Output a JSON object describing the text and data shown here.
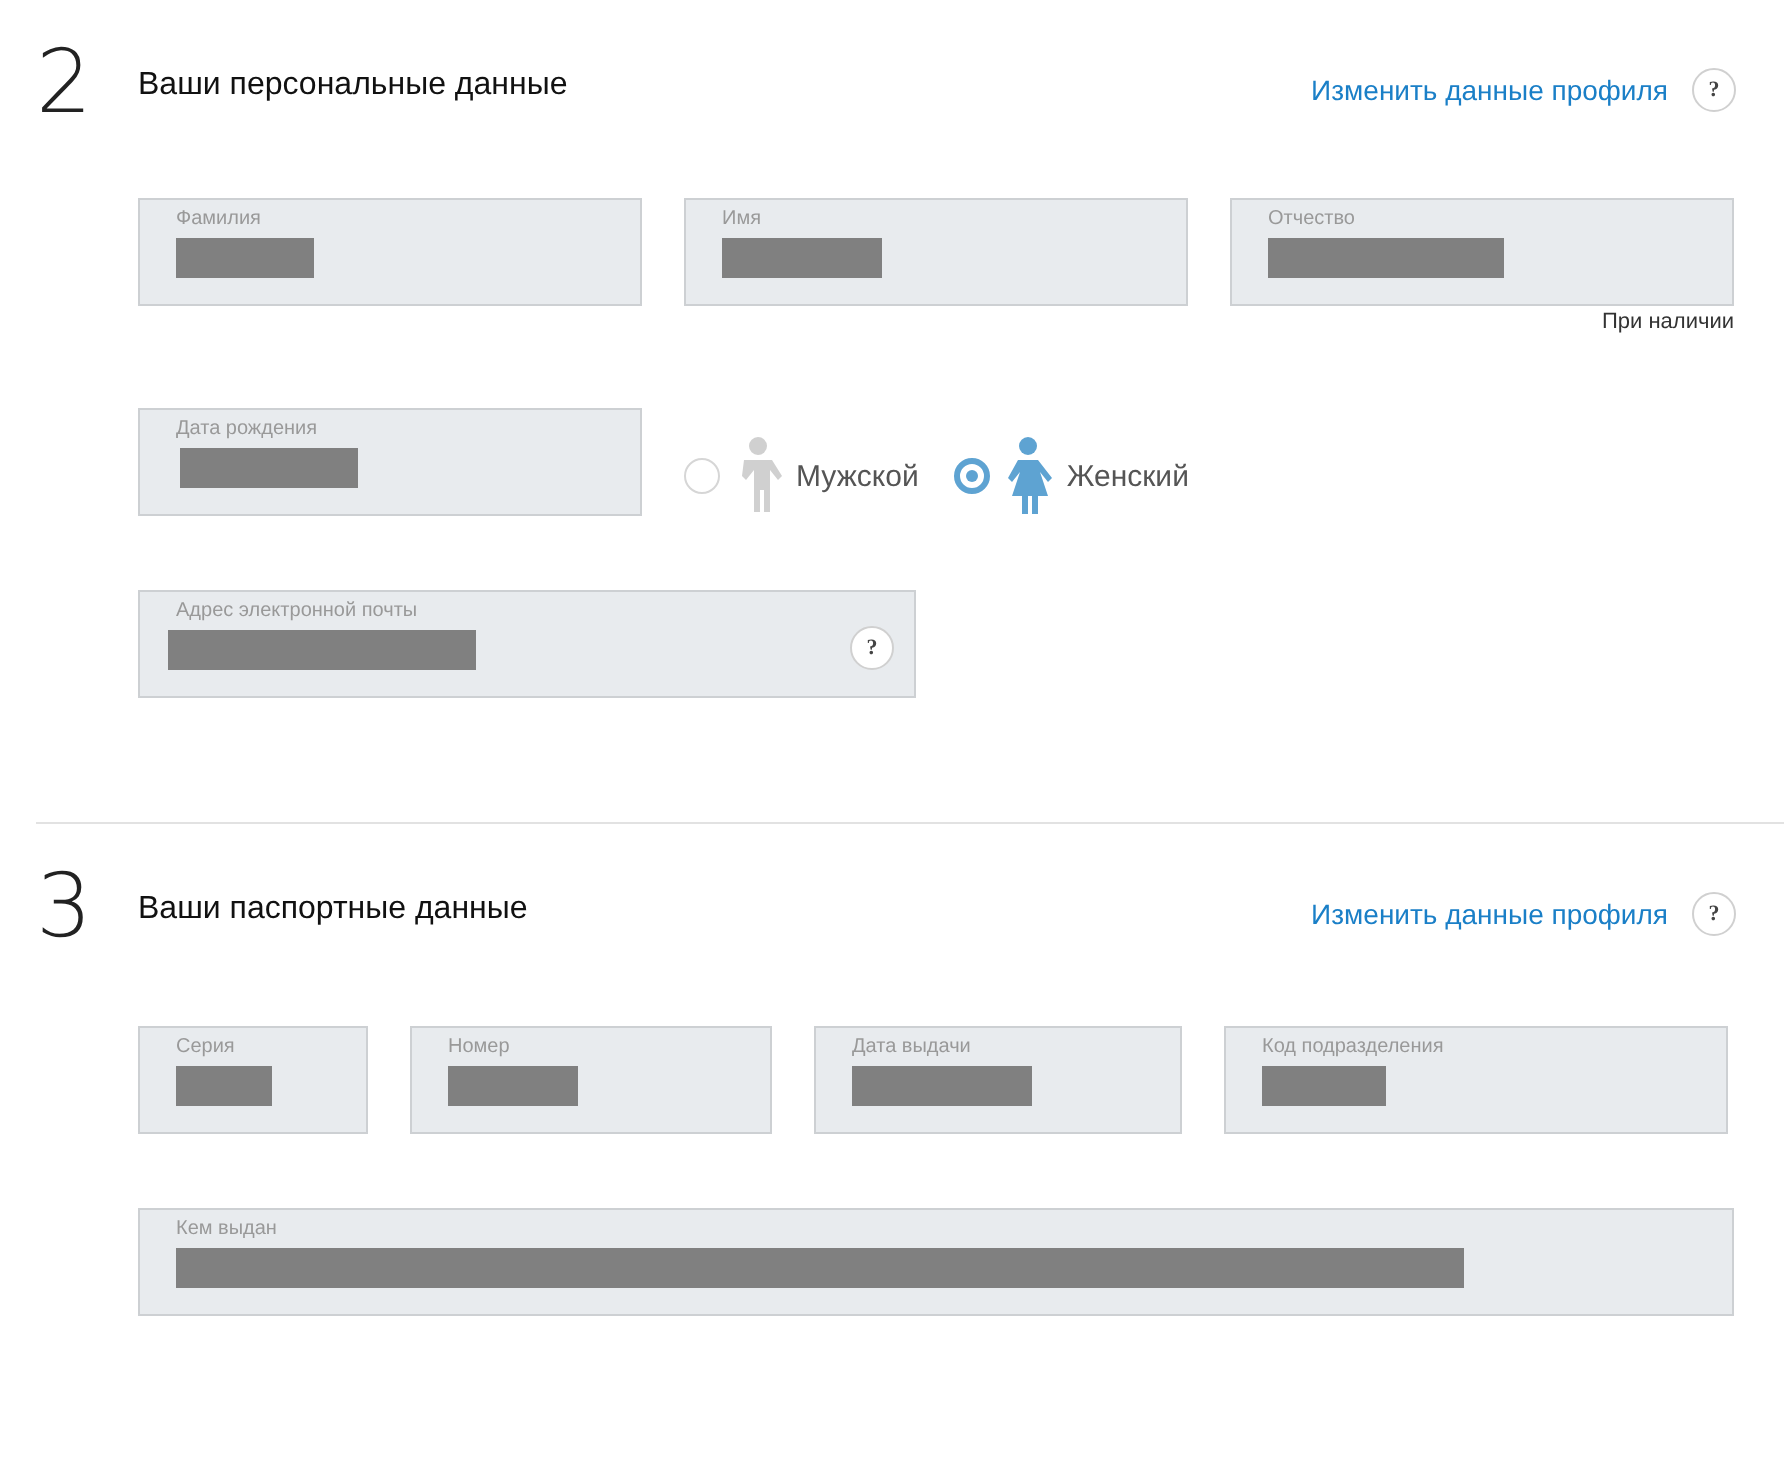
{
  "sections": [
    {
      "number": "2",
      "title": "Ваши персональные данные",
      "edit_link": "Изменить данные профиля",
      "help": "?",
      "rows": [
        [
          {
            "label": "Фамилия",
            "redacted": true
          },
          {
            "label": "Имя",
            "redacted": true
          },
          {
            "label": "Отчество",
            "redacted": true,
            "note": "При наличии"
          }
        ],
        [
          {
            "label": "Дата рождения",
            "redacted": true
          }
        ],
        [
          {
            "label": "Адрес электронной почты",
            "redacted": true,
            "help": "?"
          }
        ]
      ],
      "gender": [
        {
          "label": "Мужской",
          "kind": "male",
          "selected": false
        },
        {
          "label": "Женский",
          "kind": "female",
          "selected": true
        }
      ]
    },
    {
      "number": "3",
      "title": "Ваши паспортные данные",
      "edit_link": "Изменить данные профиля",
      "help": "?",
      "rows": [
        [
          {
            "label": "Серия",
            "redacted": true
          },
          {
            "label": "Номер",
            "redacted": true
          },
          {
            "label": "Дата выдачи",
            "redacted": true
          },
          {
            "label": "Код подразделения",
            "redacted": true
          }
        ],
        [
          {
            "label": "Кем выдан",
            "redacted": true
          }
        ]
      ]
    }
  ]
}
